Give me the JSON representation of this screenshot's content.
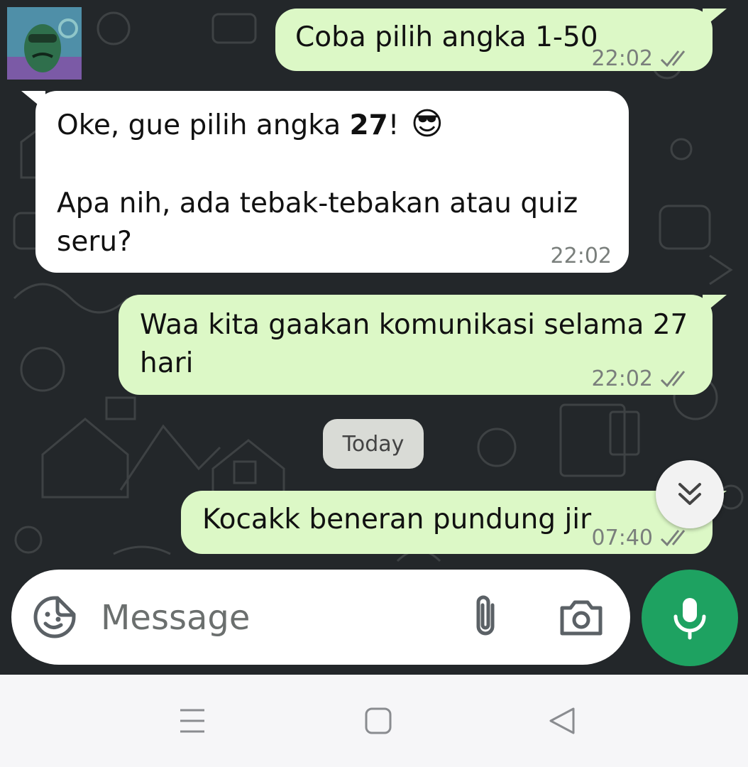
{
  "colors": {
    "background": "#23272a",
    "outgoing_bubble": "#dcf8c6",
    "incoming_bubble": "#ffffff",
    "mic_button": "#1ea261",
    "timestamp": "#7a7f7c"
  },
  "messages": [
    {
      "direction": "out",
      "text": "Coba pilih angka 1-50",
      "time": "22:02",
      "status": "read-double-tick"
    },
    {
      "direction": "in",
      "line1_prefix": "Oke, gue pilih angka ",
      "line1_bold": "27",
      "line1_suffix": "!",
      "emoji": "😎",
      "body": "Apa nih, ada tebak-tebakan atau quiz\nseru?",
      "time": "22:02"
    },
    {
      "direction": "out",
      "text": "Waa kita gaakan komunikasi selama 27\nhari",
      "time": "22:02",
      "status": "read-double-tick"
    },
    {
      "direction": "out",
      "text": "Kocakk beneran pundung jir",
      "time": "07:40",
      "status": "read-double-tick"
    }
  ],
  "date_separator": "Today",
  "composer": {
    "placeholder": "Message",
    "emoji_icon": "sticker-smiley-icon",
    "attach_icon": "paperclip-icon",
    "camera_icon": "camera-icon",
    "mic_icon": "microphone-icon"
  },
  "scroll_button_icon": "double-chevron-down-icon",
  "navbar": {
    "icons": [
      "menu-icon",
      "home-square-icon",
      "back-triangle-icon"
    ]
  }
}
